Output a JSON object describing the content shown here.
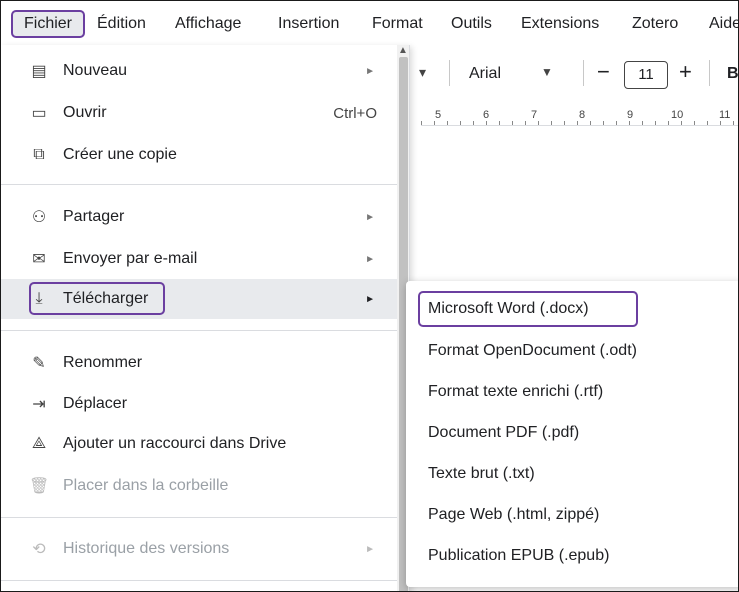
{
  "menubar": {
    "items": [
      "Fichier",
      "Édition",
      "Affichage",
      "Insertion",
      "Format",
      "Outils",
      "Extensions",
      "Zotero",
      "Aide"
    ]
  },
  "toolbar": {
    "font": "Arial",
    "font_size": "11",
    "minus": "−",
    "plus": "+",
    "bold": "B",
    "ruler_ticks": [
      "5",
      "6",
      "7",
      "8",
      "9",
      "10",
      "11"
    ]
  },
  "file_menu": {
    "items": [
      {
        "label": "Nouveau",
        "icon": "document-icon",
        "glyph": "▤",
        "shortcut": "",
        "submenu": true
      },
      {
        "label": "Ouvrir",
        "icon": "folder-icon",
        "glyph": "▭",
        "shortcut": "Ctrl+O",
        "submenu": false
      },
      {
        "label": "Créer une copie",
        "icon": "copy-icon",
        "glyph": "⧉",
        "shortcut": "",
        "submenu": false
      },
      {
        "label": "Partager",
        "icon": "share-person-icon",
        "glyph": "⚇",
        "shortcut": "",
        "submenu": true
      },
      {
        "label": "Envoyer par e-mail",
        "icon": "mail-icon",
        "glyph": "✉",
        "shortcut": "",
        "submenu": true
      },
      {
        "label": "Télécharger",
        "icon": "download-icon",
        "glyph": "⤓",
        "shortcut": "",
        "submenu": true
      },
      {
        "label": "Renommer",
        "icon": "rename-icon",
        "glyph": "✎",
        "shortcut": "",
        "submenu": false
      },
      {
        "label": "Déplacer",
        "icon": "move-folder-icon",
        "glyph": "⇥",
        "shortcut": "",
        "submenu": false
      },
      {
        "label": "Ajouter un raccourci dans Drive",
        "icon": "drive-shortcut-icon",
        "glyph": "⟁",
        "shortcut": "",
        "submenu": false
      },
      {
        "label": "Placer dans la corbeille",
        "icon": "trash-icon",
        "glyph": "🗑",
        "shortcut": "",
        "submenu": false
      },
      {
        "label": "Historique des versions",
        "icon": "history-icon",
        "glyph": "⟲",
        "shortcut": "",
        "submenu": true
      }
    ]
  },
  "download_submenu": {
    "items": [
      "Microsoft Word (.docx)",
      "Format OpenDocument (.odt)",
      "Format texte enrichi (.rtf)",
      "Document PDF (.pdf)",
      "Texte brut (.txt)",
      "Page Web (.html, zippé)",
      "Publication EPUB (.epub)"
    ]
  },
  "colors": {
    "highlight_border": "#6b3fa0",
    "active_bg": "#e8eaed",
    "disabled_text": "#9aa0a6"
  }
}
